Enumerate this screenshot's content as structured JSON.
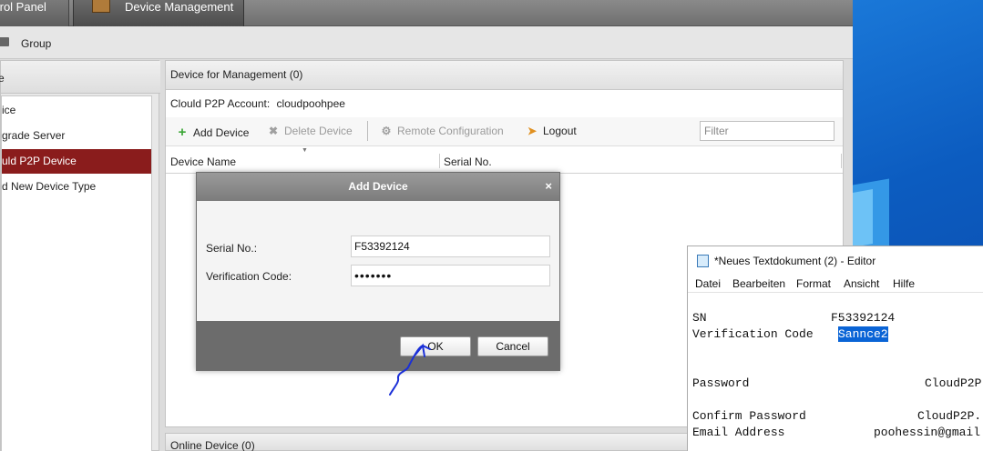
{
  "top_tabs": {
    "control_panel": "trol Panel",
    "device_management": "Device Management"
  },
  "subbar": {
    "group_label": "Group"
  },
  "left_panel": {
    "header": "e",
    "items": [
      {
        "label": "ice",
        "selected": false
      },
      {
        "label": "grade Server",
        "selected": false
      },
      {
        "label": "uld P2P Device",
        "selected": true
      },
      {
        "label": "d New Device Type",
        "selected": false
      }
    ]
  },
  "main": {
    "header": "Device for Management (0)",
    "account_label": "Clould P2P Account:",
    "account_value": "cloudpoohpee",
    "toolbar": {
      "add": "Add Device",
      "delete": "Delete Device",
      "remote": "Remote Configuration",
      "logout": "Logout",
      "filter_placeholder": "Filter"
    },
    "table": {
      "columns": [
        "Device Name",
        "Serial No."
      ]
    },
    "online_header": "Online Device (0)"
  },
  "dialog": {
    "title": "Add Device",
    "close": "×",
    "serial_label": "Serial No.:",
    "serial_value": "F53392124",
    "verification_label": "Verification Code:",
    "verification_value": "•••••••",
    "ok": "OK",
    "cancel": "Cancel"
  },
  "notepad": {
    "title": "*Neues Textdokument (2) - Editor",
    "menus": [
      "Datei",
      "Bearbeiten",
      "Format",
      "Ansicht",
      "Hilfe"
    ],
    "lines": {
      "sn_key": "SN",
      "sn_value": "F53392124",
      "vc_key": "Verification Code",
      "vc_value": "Sannce2",
      "pw_key": "Password",
      "pw_value": "CloudP2P",
      "cpw_key": "Confirm Password",
      "cpw_value": "CloudP2P.",
      "email_key": "Email Address",
      "email_value": "poohessin@gmail"
    }
  },
  "colors": {
    "selected_item": "#8a1c1c",
    "desktop_blue": "#0c5cc0",
    "text_selection": "#0a64d6",
    "pen_annotation": "#1a2fd8"
  }
}
